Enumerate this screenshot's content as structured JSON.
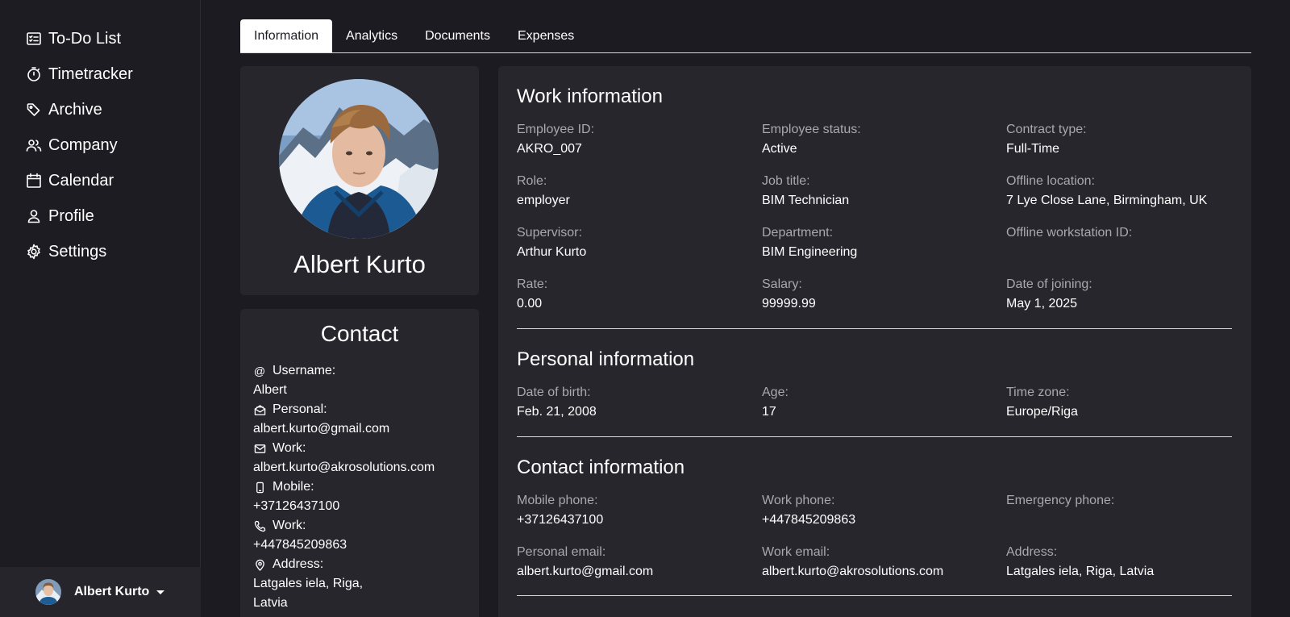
{
  "sidebar": {
    "items": [
      {
        "label": "To-Do List",
        "icon": "todo-list-icon"
      },
      {
        "label": "Timetracker",
        "icon": "stopwatch-icon"
      },
      {
        "label": "Archive",
        "icon": "tag-icon"
      },
      {
        "label": "Company",
        "icon": "users-icon"
      },
      {
        "label": "Calendar",
        "icon": "calendar-icon"
      },
      {
        "label": "Profile",
        "icon": "user-icon"
      },
      {
        "label": "Settings",
        "icon": "gear-icon"
      }
    ],
    "user": {
      "name": "Albert Kurto"
    }
  },
  "tabs": [
    {
      "label": "Information",
      "active": true
    },
    {
      "label": "Analytics",
      "active": false
    },
    {
      "label": "Documents",
      "active": false
    },
    {
      "label": "Expenses",
      "active": false
    }
  ],
  "profile": {
    "name": "Albert Kurto"
  },
  "contact": {
    "title": "Contact",
    "items": [
      {
        "icon": "at-icon",
        "label": "Username:",
        "value": "Albert"
      },
      {
        "icon": "mail-open-icon",
        "label": "Personal:",
        "value": "albert.kurto@gmail.com"
      },
      {
        "icon": "mail-icon",
        "label": "Work:",
        "value": "albert.kurto@akrosolutions.com"
      },
      {
        "icon": "mobile-icon",
        "label": "Mobile:",
        "value": "+37126437100"
      },
      {
        "icon": "phone-icon",
        "label": "Work:",
        "value": "+447845209863"
      },
      {
        "icon": "location-pin-icon",
        "label": "Address:",
        "value_lines": [
          "Latgales iela, Riga,",
          "Latvia"
        ]
      }
    ]
  },
  "work": {
    "title": "Work information",
    "fields": [
      {
        "label": "Employee ID:",
        "value": "AKRO_007"
      },
      {
        "label": "Employee status:",
        "value": "Active"
      },
      {
        "label": "Contract type:",
        "value": "Full-Time"
      },
      {
        "label": "Role:",
        "value": "employer"
      },
      {
        "label": "Job title:",
        "value": "BIM Technician"
      },
      {
        "label": "Offline location:",
        "value": "7 Lye Close Lane, Birmingham, UK"
      },
      {
        "label": "Supervisor:",
        "value": "Arthur Kurto"
      },
      {
        "label": "Department:",
        "value": "BIM Engineering"
      },
      {
        "label": "Offline workstation ID:",
        "value": ""
      },
      {
        "label": "Rate:",
        "value": "0.00"
      },
      {
        "label": "Salary:",
        "value": "99999.99"
      },
      {
        "label": "Date of joining:",
        "value": "May 1, 2025"
      }
    ]
  },
  "personal": {
    "title": "Personal information",
    "fields": [
      {
        "label": "Date of birth:",
        "value": "Feb. 21, 2008"
      },
      {
        "label": "Age:",
        "value": "17"
      },
      {
        "label": "Time zone:",
        "value": "Europe/Riga"
      }
    ]
  },
  "contact_info": {
    "title": "Contact information",
    "fields": [
      {
        "label": "Mobile phone:",
        "value": "+37126437100"
      },
      {
        "label": "Work phone:",
        "value": "+447845209863"
      },
      {
        "label": "Emergency phone:",
        "value": ""
      },
      {
        "label": "Personal email:",
        "value": "albert.kurto@gmail.com"
      },
      {
        "label": "Work email:",
        "value": "albert.kurto@akrosolutions.com"
      },
      {
        "label": "Address:",
        "value": "Latgales iela, Riga, Latvia"
      }
    ]
  }
}
